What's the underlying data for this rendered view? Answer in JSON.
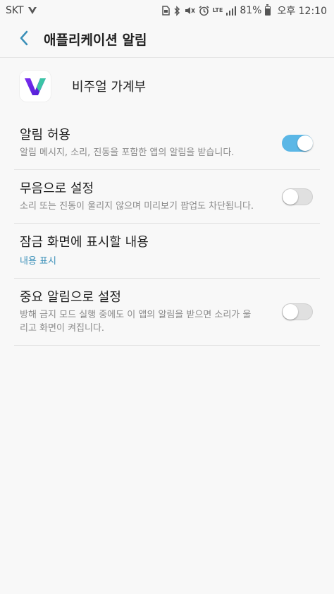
{
  "status_bar": {
    "carrier": "SKT",
    "lte": "LTE",
    "battery": "81%",
    "time": "오후 12:10",
    "icons": [
      "carrier-v-icon",
      "sim-icon",
      "bluetooth-icon",
      "mute-icon",
      "alarm-icon",
      "lte-icon",
      "signal-icon",
      "battery-icon"
    ]
  },
  "app_bar": {
    "title": "애플리케이션 알림",
    "back_icon": "back-arrow-icon"
  },
  "app": {
    "name": "비주얼 가계부",
    "icon": "visual-ledger-app-icon"
  },
  "settings": [
    {
      "title": "알림 허용",
      "description": "알림 메시지, 소리, 진동을 포함한 앱의 알림을 받습니다.",
      "toggle": true
    },
    {
      "title": "무음으로 설정",
      "description": "소리 또는 진동이 울리지 않으며 미리보기 팝업도 차단됩니다.",
      "toggle": false
    },
    {
      "title": "잠금 화면에 표시할 내용",
      "value": "내용 표시"
    },
    {
      "title": "중요 알림으로 설정",
      "description": "방해 금지 모드 실행 중에도 이 앱의 알림을 받으면 소리가 울리고 화면이 켜집니다.",
      "toggle": false
    }
  ],
  "colors": {
    "accent": "#5bb7e6",
    "link": "#3a8fb8",
    "background": "#f8f8f8"
  }
}
